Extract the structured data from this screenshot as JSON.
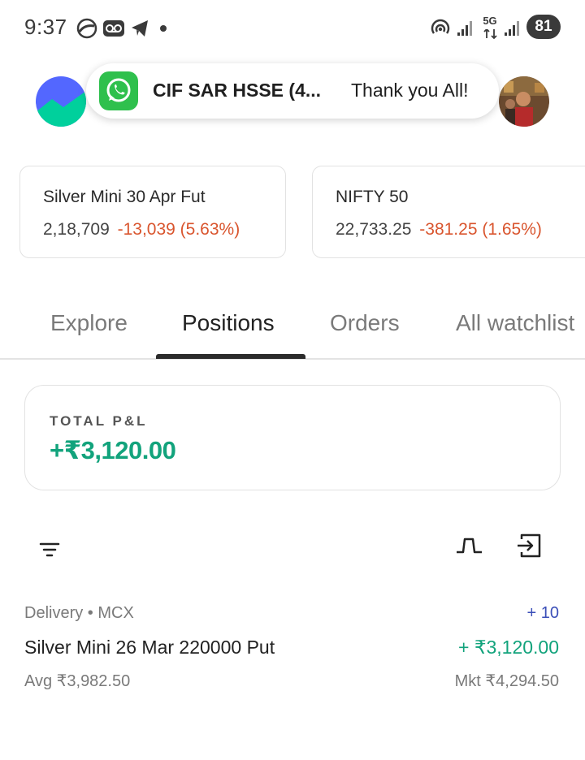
{
  "status_bar": {
    "time": "9:37",
    "battery": "81",
    "network": "5G",
    "icons": [
      "cast-icon",
      "voicemail-icon",
      "telegram-icon",
      "dot-icon",
      "hotspot-icon",
      "signal-icon",
      "signal-icon"
    ]
  },
  "notification": {
    "app": "WhatsApp",
    "title": "CIF SAR HSSE (4...",
    "message": "Thank you All!"
  },
  "tickers": [
    {
      "name": "Silver Mini 30 Apr Fut",
      "price": "2,18,709",
      "change": "-13,039 (5.63%)"
    },
    {
      "name": "NIFTY 50",
      "price": "22,733.25",
      "change": "-381.25 (1.65%)"
    }
  ],
  "tabs": {
    "explore": "Explore",
    "positions": "Positions",
    "orders": "Orders",
    "watchlist": "All watchlist"
  },
  "pnl": {
    "label": "TOTAL P&L",
    "value": "+₹3,120.00"
  },
  "position": {
    "meta": "Delivery • MCX",
    "qty": "+ 10",
    "name": "Silver Mini 26 Mar 220000 Put",
    "pnl": "+ ₹3,120.00",
    "avg": "Avg ₹3,982.50",
    "mkt": "Mkt ₹4,294.50"
  },
  "colors": {
    "profit": "#12a37c",
    "loss": "#d9552e",
    "qty": "#3b4fb8"
  }
}
